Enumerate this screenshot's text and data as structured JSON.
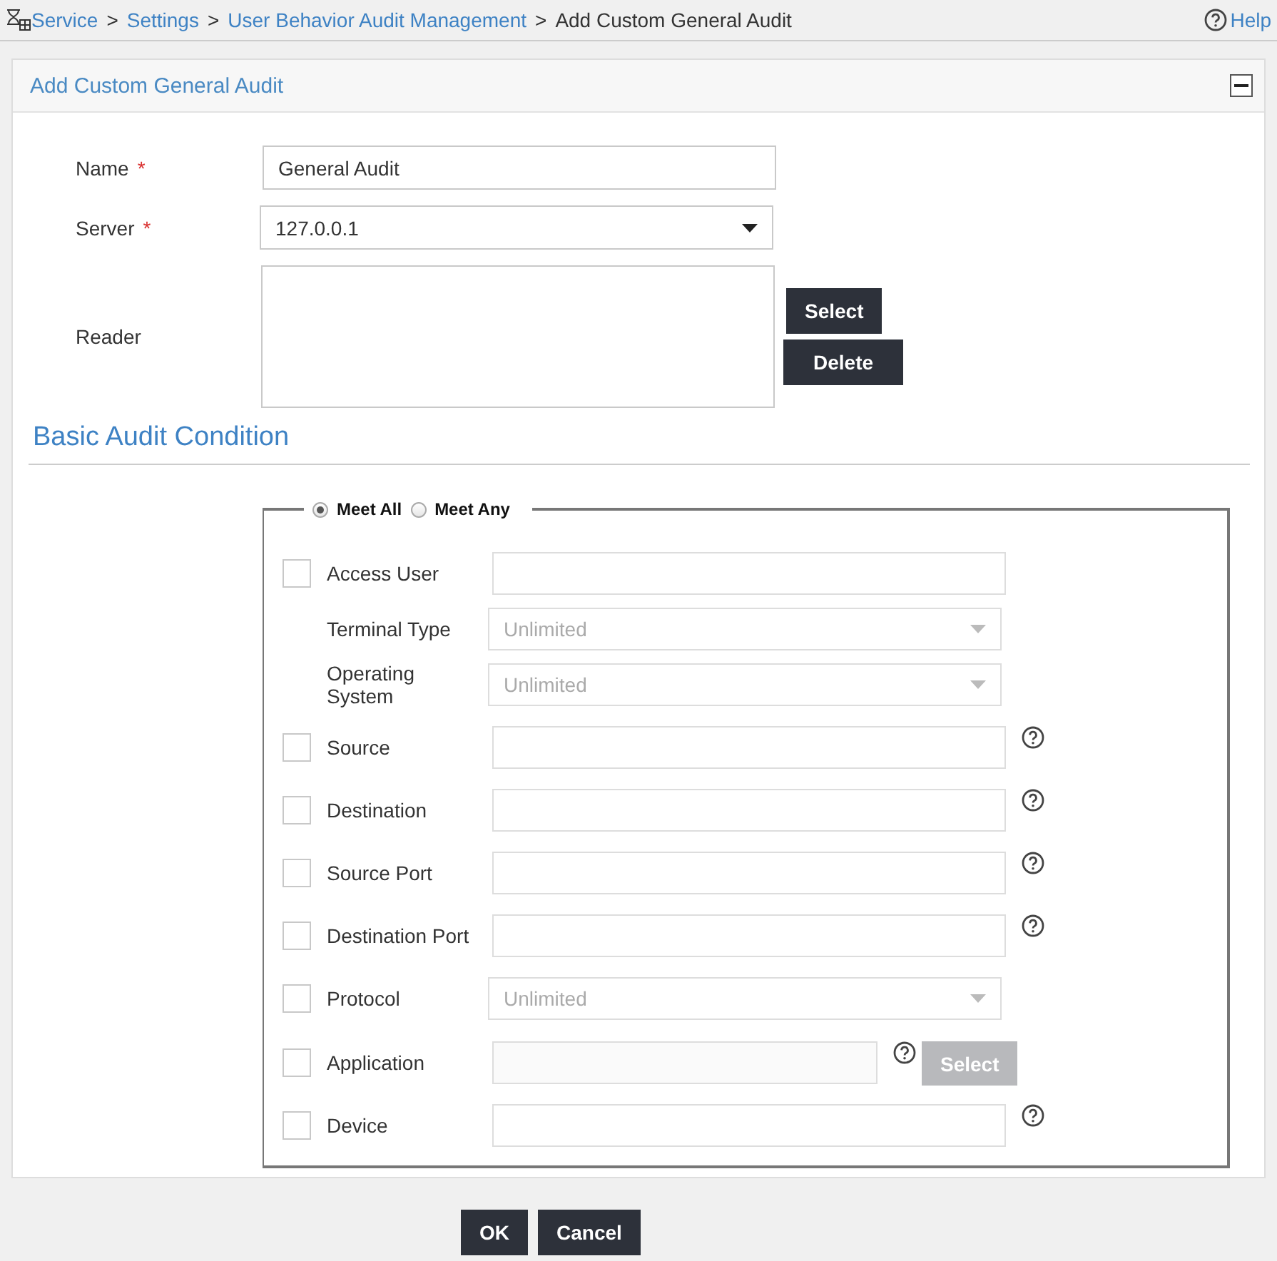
{
  "breadcrumb": [
    {
      "label": "Service",
      "kind": "link"
    },
    {
      "label": "Settings",
      "kind": "link"
    },
    {
      "label": "User Behavior Audit Management",
      "kind": "link"
    },
    {
      "label": "Add Custom General Audit",
      "kind": "current"
    }
  ],
  "breadcrumb_separator": ">",
  "help": "Help",
  "panel": {
    "title": "Add Custom General Audit"
  },
  "form": {
    "name": {
      "label": "Name",
      "required_mark": "*",
      "value": "General Audit"
    },
    "server": {
      "label": "Server",
      "required_mark": "*",
      "value": "127.0.0.1"
    },
    "reader": {
      "label": "Reader",
      "buttons": [
        "Select",
        "Delete"
      ]
    }
  },
  "section_title": "Basic Audit Condition",
  "match": [
    {
      "label": "Meet All",
      "selected": true
    },
    {
      "label": "Meet Any",
      "selected": false
    }
  ],
  "conditions": [
    {
      "label": "Access User",
      "checked": false,
      "kind": "text",
      "help": false,
      "children": [
        {
          "label": "Terminal Type",
          "kind": "select",
          "value": "Unlimited"
        },
        {
          "label": "Operating System",
          "kind": "select",
          "value": "Unlimited"
        }
      ]
    },
    {
      "label": "Source",
      "checked": false,
      "kind": "text",
      "help": true
    },
    {
      "label": "Destination",
      "checked": false,
      "kind": "text",
      "help": true
    },
    {
      "label": "Source Port",
      "checked": false,
      "kind": "text",
      "help": true
    },
    {
      "label": "Destination Port",
      "checked": false,
      "kind": "text",
      "help": true
    },
    {
      "label": "Protocol",
      "checked": false,
      "kind": "select",
      "value": "Unlimited",
      "help": false
    },
    {
      "label": "Application",
      "checked": false,
      "kind": "picker",
      "help": true,
      "button": "Select",
      "disabled": true
    },
    {
      "label": "Device",
      "checked": false,
      "kind": "text",
      "help": true
    }
  ],
  "buttons": [
    "OK",
    "Cancel"
  ]
}
